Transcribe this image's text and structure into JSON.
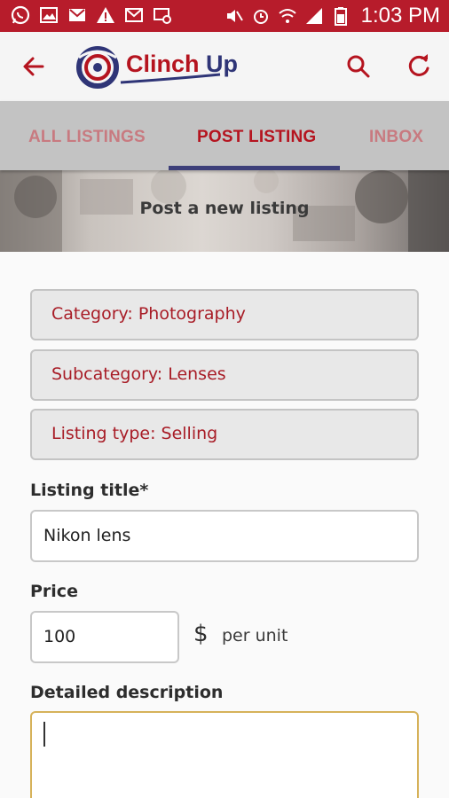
{
  "status_bar": {
    "time": "1:03 PM",
    "bar_color": "#b71c2b",
    "left_icons": [
      "whatsapp-icon",
      "image-icon",
      "gmail-icon",
      "warning-icon",
      "email-icon",
      "settings-email-icon"
    ],
    "right_icons": [
      "mute-icon",
      "alarm-icon",
      "wifi-icon",
      "signal-icon",
      "battery-icon"
    ]
  },
  "app_bar": {
    "logo_text": "Clinch Up",
    "accent_color": "#b5141f",
    "brand_navy": "#2f3577"
  },
  "tabs": {
    "items": [
      {
        "label": "ALL LISTINGS",
        "selected": false
      },
      {
        "label": "POST LISTING",
        "selected": true
      },
      {
        "label": "INBOX",
        "selected": false
      }
    ]
  },
  "banner": {
    "title": "Post a new listing"
  },
  "form": {
    "category_label": "Category: Photography",
    "subcategory_label": "Subcategory: Lenses",
    "listing_type_label": "Listing type: Selling",
    "title_label": "Listing title*",
    "title_value": "Nikon lens",
    "price_label": "Price",
    "price_value": "100",
    "currency_symbol": "$",
    "price_unit": "per unit",
    "description_label": "Detailed description",
    "description_value": ""
  }
}
